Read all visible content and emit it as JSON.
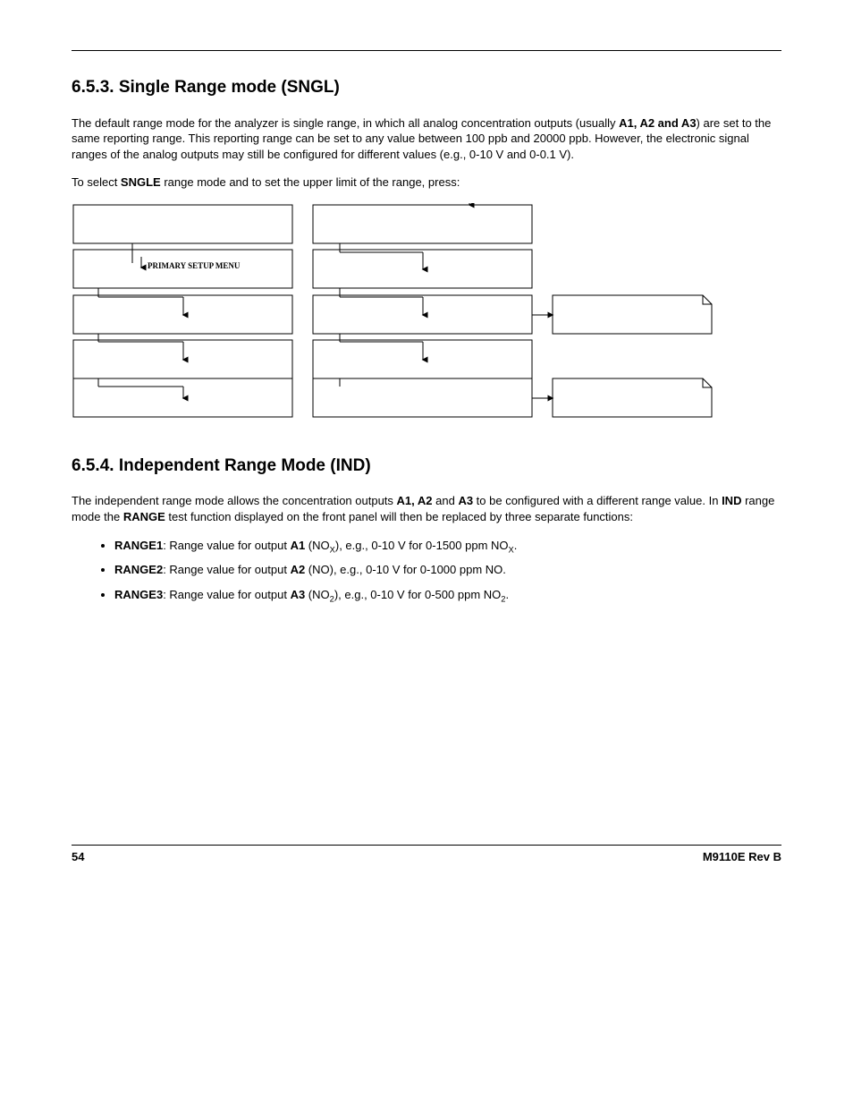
{
  "section1": {
    "heading": "6.5.3. Single Range mode (SNGL)",
    "p1_a": "The default range mode for the analyzer is single range, in which all analog concentration outputs (usually ",
    "p1_b": "A1, A2 and A3",
    "p1_c": ") are set to the same reporting range. This reporting range can be set to any value between 100 ppb and 20000 ppb. However, the electronic signal ranges of the analog outputs may still be configured for different values (e.g., 0-10 V and 0-0.1 V).",
    "p2_a": "To select ",
    "p2_b": "SNGLE",
    "p2_c": " range mode and to set the upper limit of the range, press:"
  },
  "diagram": {
    "primary_setup_label": "PRIMARY SETUP MENU"
  },
  "section2": {
    "heading": "6.5.4. Independent Range Mode (IND)",
    "p1_a": "The independent range mode allows the concentration outputs ",
    "p1_b": "A1, A2",
    "p1_c": " and ",
    "p1_d": "A3",
    "p1_e": " to be configured with a different range value. In ",
    "p1_f": "IND",
    "p1_g": " range mode the ",
    "p1_h": "RANGE",
    "p1_i": " test function displayed on the front panel will then be replaced by three separate functions:",
    "bullets": {
      "b1_a": "RANGE1",
      "b1_b": ": Range value for output ",
      "b1_c": "A1",
      "b1_d": " (NO",
      "b1_sub": "X",
      "b1_e": "), e.g., 0-10 V for 0-1500 ppm NO",
      "b1_sub2": "X",
      "b1_f": ".",
      "b2_a": "RANGE2",
      "b2_b": ": Range value for output ",
      "b2_c": "A2",
      "b2_d": " (NO), e.g., 0-10 V for 0-1000 ppm NO.",
      "b3_a": "RANGE3",
      "b3_b": ": Range value for output ",
      "b3_c": "A3",
      "b3_d": " (NO",
      "b3_sub": "2",
      "b3_e": "), e.g., 0-10 V for 0-500 ppm NO",
      "b3_sub2": "2",
      "b3_f": "."
    }
  },
  "footer": {
    "page_num": "54",
    "doc_rev": "M9110E Rev B"
  }
}
